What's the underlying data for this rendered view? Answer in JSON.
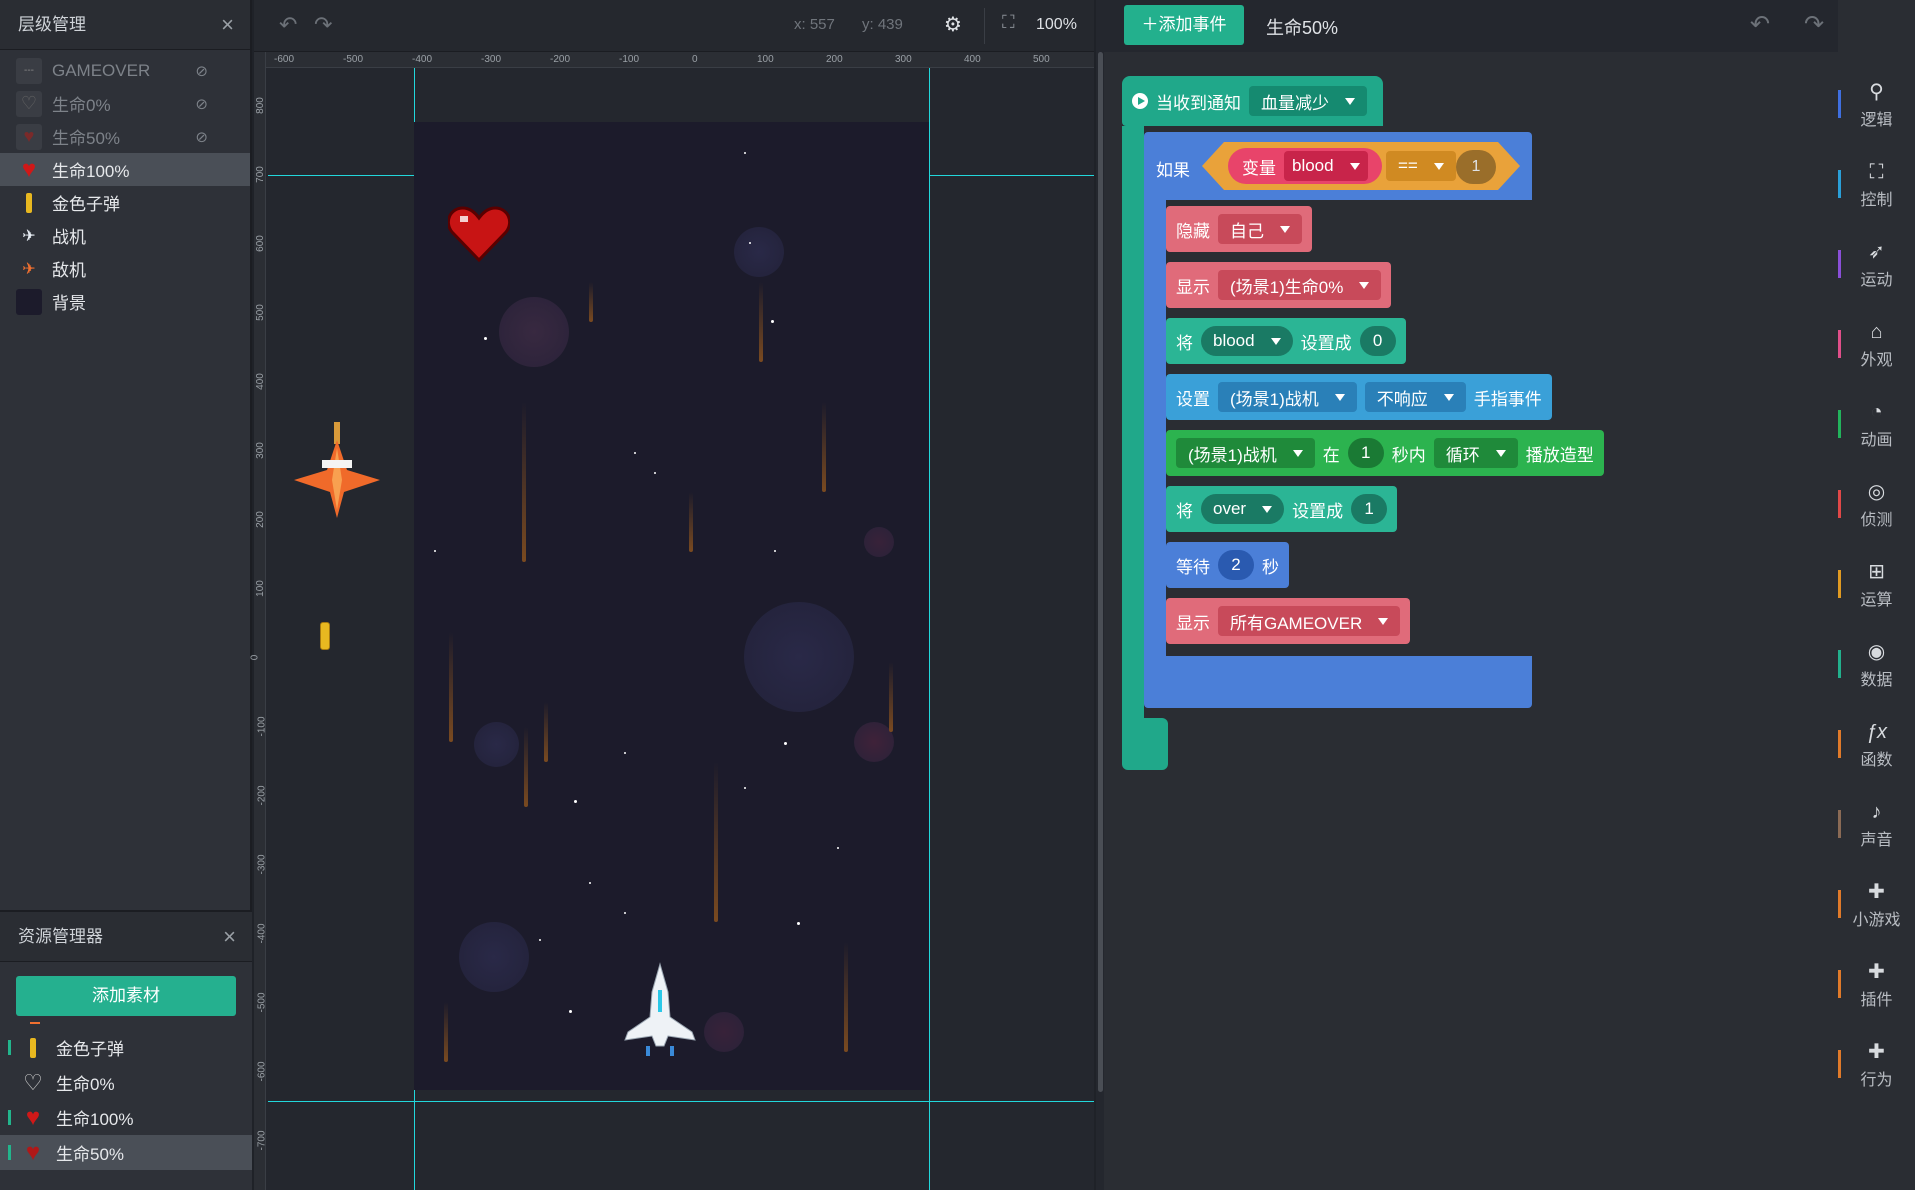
{
  "layers_panel": {
    "title": "层级管理",
    "items": [
      {
        "label": "GAMEOVER",
        "hidden": true
      },
      {
        "label": "生命0%",
        "hidden": true
      },
      {
        "label": "生命50%",
        "hidden": true
      },
      {
        "label": "生命100%",
        "selected": true
      },
      {
        "label": "金色子弹"
      },
      {
        "label": "战机"
      },
      {
        "label": "敌机"
      },
      {
        "label": "背景"
      }
    ]
  },
  "resources_panel": {
    "title": "资源管理器",
    "add_button": "添加素材",
    "items": [
      {
        "label": "金色子弹"
      },
      {
        "label": "生命0%"
      },
      {
        "label": "生命100%"
      },
      {
        "label": "生命50%",
        "selected": true
      }
    ]
  },
  "stage_toolbar": {
    "x": "x: 557",
    "y": "y: 439",
    "zoom": "100%"
  },
  "ruler": {
    "h_ticks": [
      "-600",
      "-500",
      "-400",
      "-300",
      "-200",
      "-100",
      "0",
      "100",
      "200",
      "300",
      "400",
      "500"
    ],
    "v_ticks": [
      "800",
      "700",
      "600",
      "500",
      "400",
      "300",
      "200",
      "100",
      "0",
      "-100",
      "-200",
      "-300",
      "-400",
      "-500",
      "-600",
      "-700"
    ]
  },
  "blocks_toolbar": {
    "add_event": "添加事件",
    "scene_name": "生命50%"
  },
  "blocks": {
    "event": {
      "label": "当收到通知",
      "value": "血量减少"
    },
    "if": {
      "label": "如果",
      "var_label": "变量",
      "var_value": "blood",
      "op": "==",
      "num": "1"
    },
    "hide": {
      "label": "隐藏",
      "value": "自己"
    },
    "show1": {
      "label": "显示",
      "value": "(场景1)生命0%"
    },
    "set1": {
      "label": "将",
      "var": "blood",
      "set": "设置成",
      "num": "0"
    },
    "setting": {
      "label": "设置",
      "target": "(场景1)战机",
      "mode": "不响应",
      "suffix": "手指事件"
    },
    "anim": {
      "target": "(场景1)战机",
      "in": "在",
      "num": "1",
      "sec": "秒内",
      "mode": "循环",
      "suffix": "播放造型"
    },
    "set2": {
      "label": "将",
      "var": "over",
      "set": "设置成",
      "num": "1"
    },
    "wait": {
      "label": "等待",
      "num": "2",
      "unit": "秒"
    },
    "show2": {
      "label": "显示",
      "value": "所有GAMEOVER"
    }
  },
  "categories": [
    {
      "label": "逻辑",
      "icon": "hierarchy-icon",
      "glyph": "⚲",
      "color": "#3f6fe0"
    },
    {
      "label": "控制",
      "icon": "joystick-icon",
      "glyph": "⛶",
      "color": "#2a9fd8"
    },
    {
      "label": "运动",
      "icon": "running-icon",
      "glyph": "✈",
      "color": "#8a4fd8"
    },
    {
      "label": "外观",
      "icon": "shirt-icon",
      "glyph": "👕",
      "color": "#e04f8a"
    },
    {
      "label": "动画",
      "icon": "animation-icon",
      "glyph": "◔",
      "color": "#22b35c"
    },
    {
      "label": "侦测",
      "icon": "radar-icon",
      "glyph": "◎",
      "color": "#e04848"
    },
    {
      "label": "运算",
      "icon": "calculator-icon",
      "glyph": "⊞",
      "color": "#e09a22"
    },
    {
      "label": "数据",
      "icon": "var-icon",
      "glyph": "◉",
      "color": "#22b08d"
    },
    {
      "label": "函数",
      "icon": "fx-icon",
      "glyph": "ƒx",
      "color": "#e07a2a"
    },
    {
      "label": "声音",
      "icon": "microphone-icon",
      "glyph": "🎤",
      "color": "#8a6a55"
    },
    {
      "label": "小游戏",
      "icon": "puzzle-icon",
      "glyph": "✚",
      "color": "#e07a2a"
    },
    {
      "label": "插件",
      "icon": "plugin-icon",
      "glyph": "✚",
      "color": "#e07a2a"
    },
    {
      "label": "行为",
      "icon": "robot-icon",
      "glyph": "✚",
      "color": "#e07a2a"
    }
  ]
}
